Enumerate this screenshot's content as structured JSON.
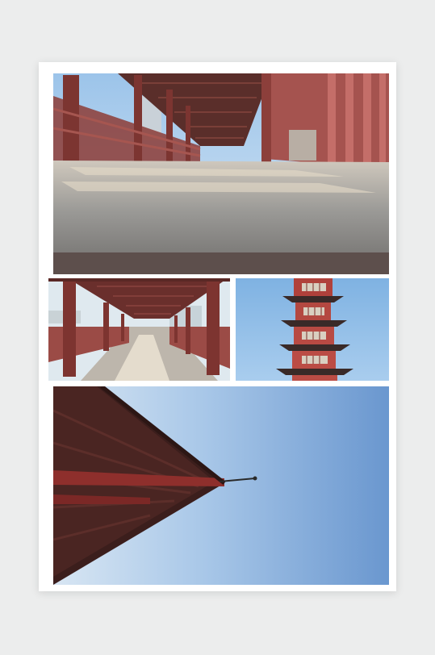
{
  "collage": {
    "photos": [
      {
        "subject": "corridor-floor-closeup"
      },
      {
        "subject": "covered-corridor"
      },
      {
        "subject": "pagoda"
      },
      {
        "subject": "roof-eave-against-sky"
      }
    ]
  }
}
